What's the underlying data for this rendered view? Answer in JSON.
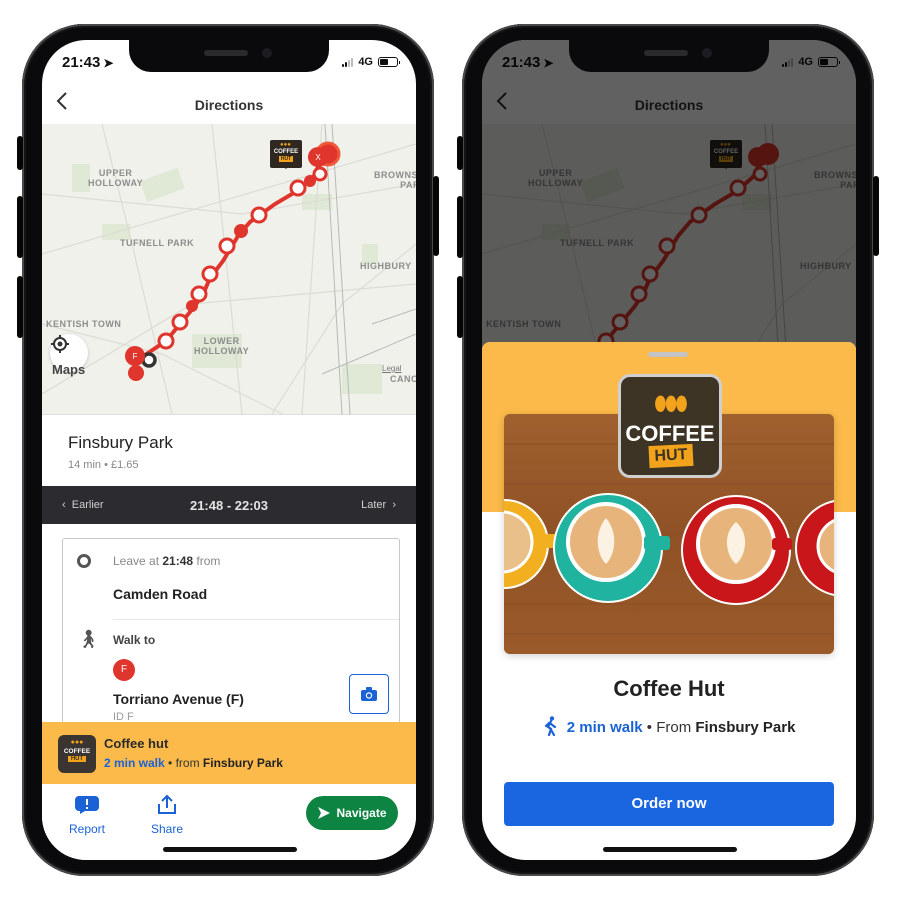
{
  "status_bar": {
    "time": "21:43",
    "network": "4G"
  },
  "navbar": {
    "title": "Directions",
    "back_icon": "chevron-left-icon"
  },
  "map": {
    "labels": {
      "upper_holloway": "UPPER\nHOLLOWAY",
      "tufnell_park": "TUFNELL PARK",
      "kentish_town": "KENTISH TOWN",
      "lower_holloway": "LOWER\nHOLLOWAY",
      "highbury": "HIGHBURY",
      "brownswood_park": "BROWNSW\nPARK",
      "canonbury": "CANON"
    },
    "coffee_pin": {
      "word": "COFFEE",
      "badge": "HUT"
    },
    "start_marker_letter": "F",
    "end_marker_letter": "X",
    "maps_logo": "Maps",
    "legal": "Legal"
  },
  "route": {
    "destination": "Finsbury Park",
    "duration": "14 min",
    "fare": "£1.65",
    "meta_separator": " • "
  },
  "time_bar": {
    "earlier": "Earlier",
    "range": "21:48 - 22:03",
    "later": "Later"
  },
  "steps": {
    "leave_prefix": "Leave at ",
    "leave_time": "21:48",
    "leave_suffix": " from",
    "start_stop": "Camden Road",
    "walk_to": "Walk to",
    "stop_badge": "F",
    "stop_name": "Torriano Avenue (F)",
    "stop_id": "ID F"
  },
  "promo": {
    "logo_word": "COFFEE",
    "logo_badge": "HUT",
    "title": "Coffee hut",
    "walk": "2 min walk",
    "from_text": " • from ",
    "from_place": "Finsbury Park"
  },
  "actions": {
    "report": "Report",
    "share": "Share",
    "navigate": "Navigate"
  },
  "sheet": {
    "logo_word": "COFFEE",
    "logo_badge": "HUT",
    "title": "Coffee Hut",
    "walk": "2 min walk",
    "from_text": " • From ",
    "from_place": "Finsbury Park",
    "order_button": "Order now"
  },
  "colors": {
    "accent_blue": "#1a62d6",
    "promo_yellow": "#fbba4a",
    "route_red": "#e0352c",
    "navigate_green": "#0e8442",
    "logo_brown": "#3d3426"
  }
}
